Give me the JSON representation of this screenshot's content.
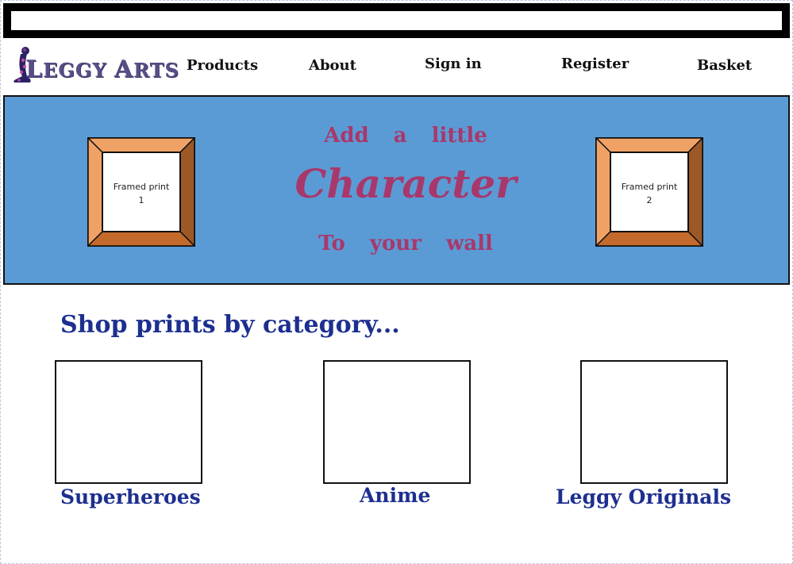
{
  "brand": {
    "name_first_cap": "L",
    "name_first_rest": "EGGY",
    "name_second_cap": "A",
    "name_second_rest": "RTS"
  },
  "nav": {
    "items": [
      {
        "label": "Products"
      },
      {
        "label": "About"
      },
      {
        "label": "Sign in"
      },
      {
        "label": "Register"
      },
      {
        "label": "Basket"
      }
    ]
  },
  "hero": {
    "line1": "Add a little",
    "line2": "Character",
    "line3": "To your wall",
    "frame1": {
      "label": "Framed print",
      "number": "1"
    },
    "frame2": {
      "label": "Framed print",
      "number": "2"
    }
  },
  "categories": {
    "title": "Shop prints by category...",
    "items": [
      {
        "label": "Superheroes"
      },
      {
        "label": "Anime"
      },
      {
        "label": "Leggy Originals"
      }
    ]
  },
  "colors": {
    "hero_bg": "#5b9bd5",
    "accent_pink": "#a8386b",
    "heading_blue": "#1d2f8f",
    "frame_wood_light": "#f0a266",
    "frame_wood_dark": "#9c5826"
  }
}
